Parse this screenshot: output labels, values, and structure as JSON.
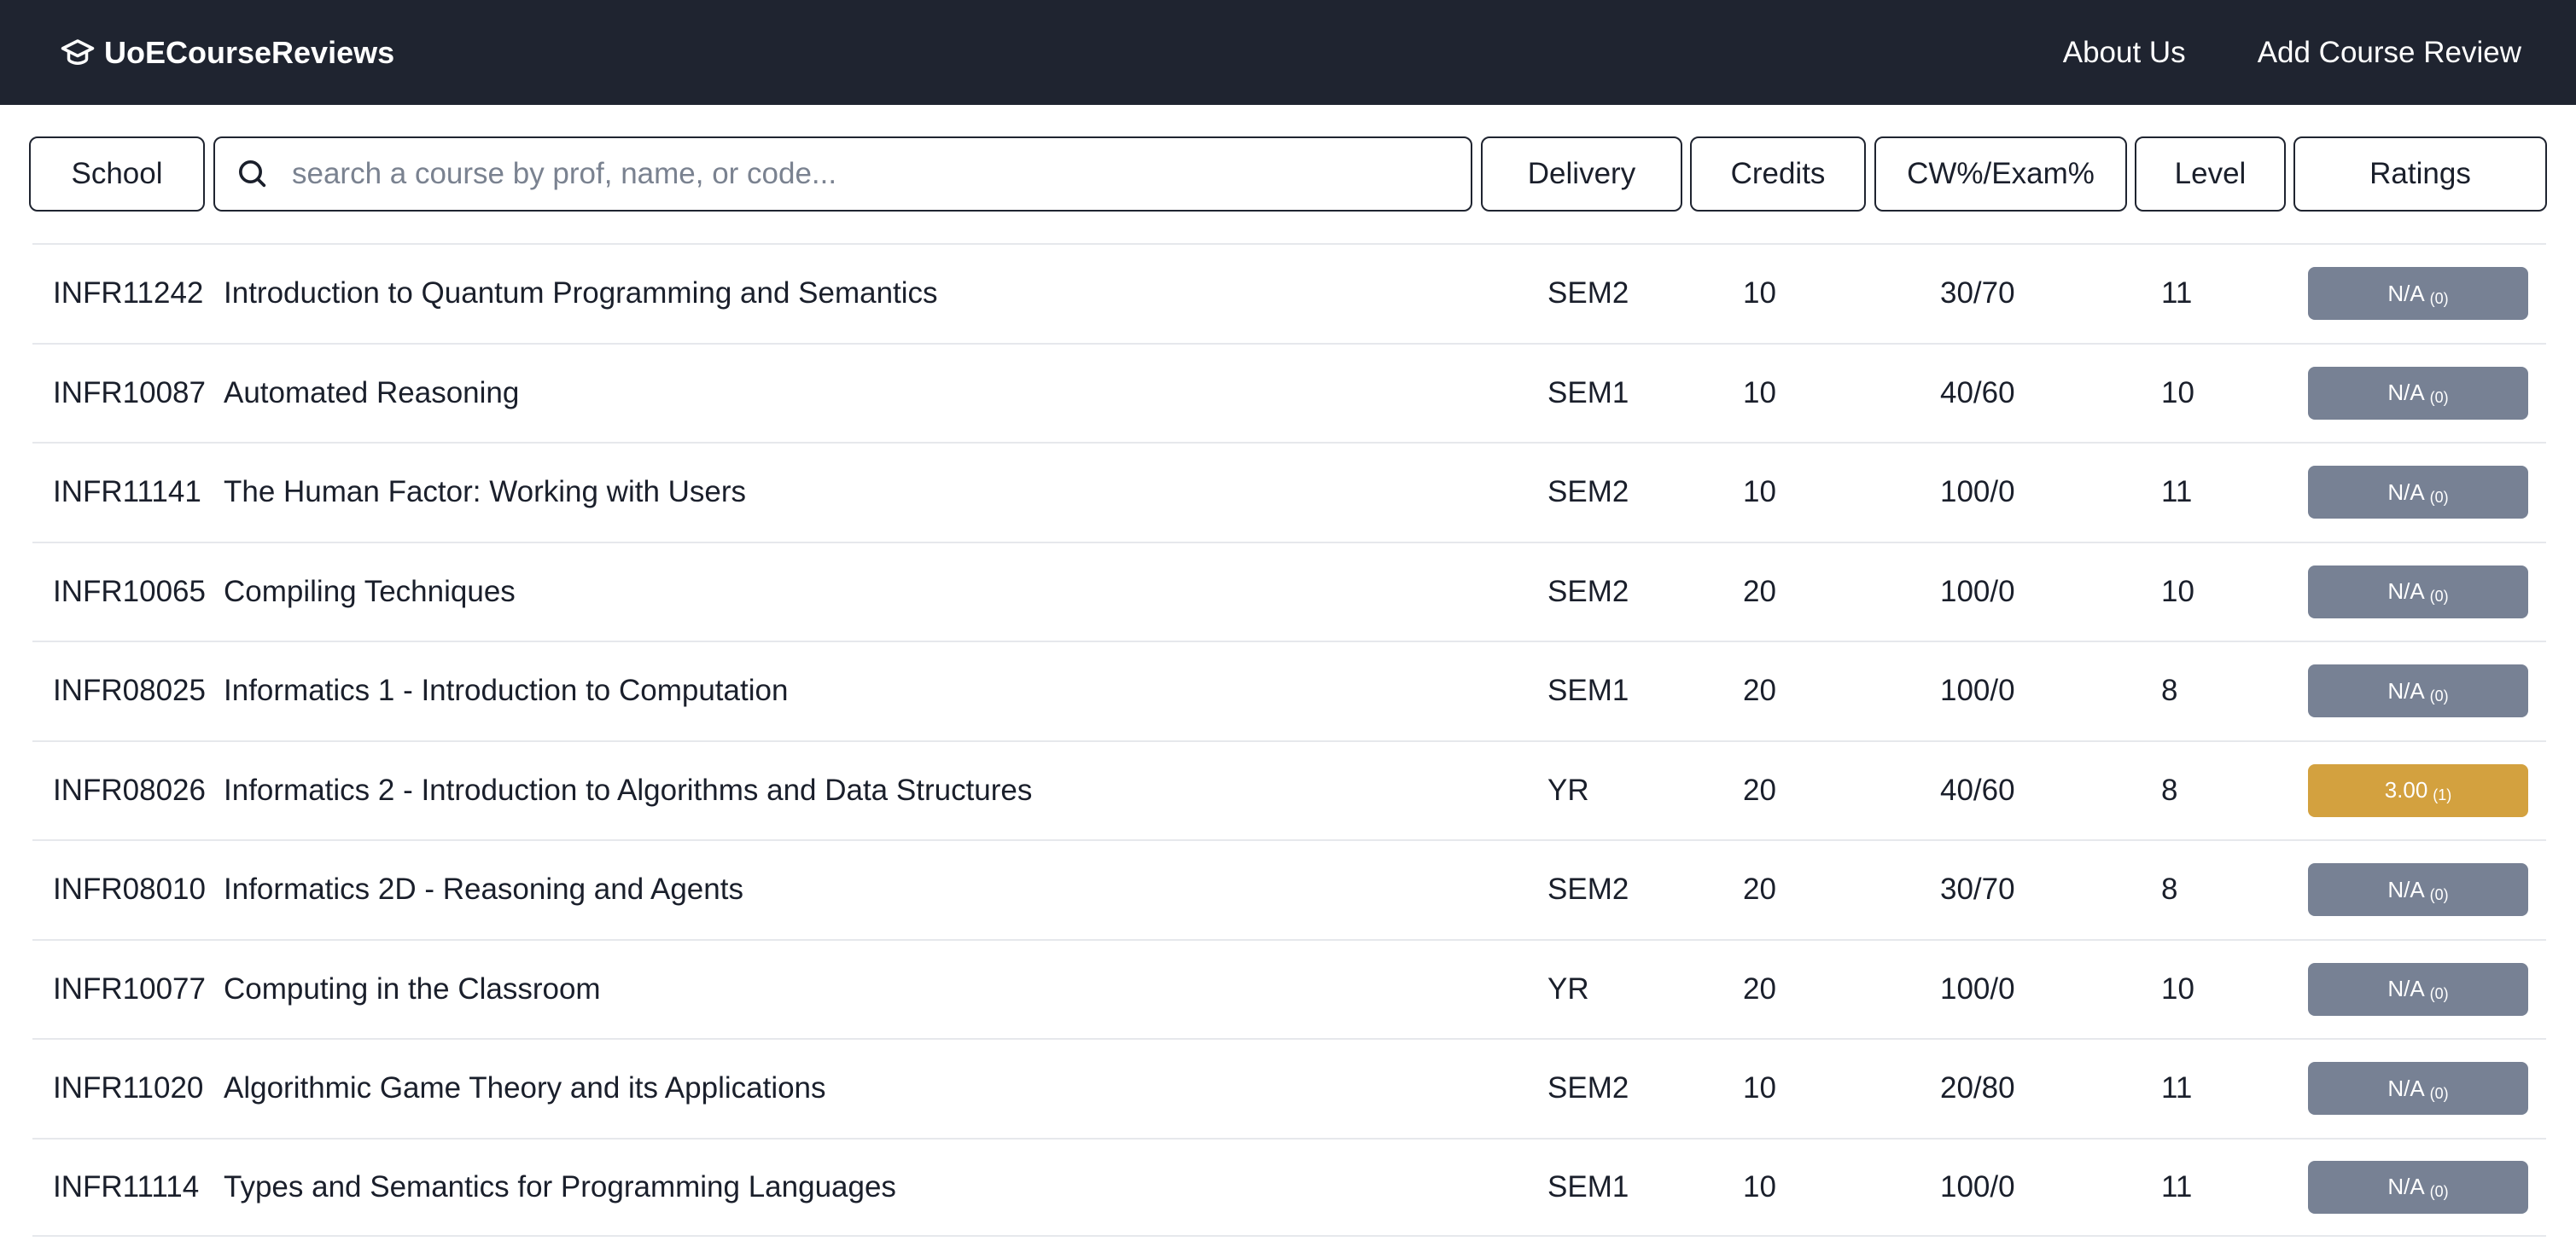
{
  "navbar": {
    "brand": "UoECourseReviews",
    "links": [
      "About Us",
      "Add Course Review"
    ]
  },
  "filters": {
    "school_label": "School",
    "search_placeholder": "search a course by prof, name, or code...",
    "search_value": "",
    "delivery_label": "Delivery",
    "credits_label": "Credits",
    "ratio_label": "CW%/Exam%",
    "level_label": "Level",
    "ratings_label": "Ratings"
  },
  "colors": {
    "navbar_bg": "#1f2430",
    "rating_na": "#778194",
    "rating_scored": "#d3a13f"
  },
  "courses": [
    {
      "code": "INFR11242",
      "name": "Introduction to Quantum Programming and Semantics",
      "delivery": "SEM2",
      "credits": "10",
      "ratio": "30/70",
      "level": "11",
      "rating": "N/A",
      "count": "(0)",
      "rated": false
    },
    {
      "code": "INFR10087",
      "name": "Automated Reasoning",
      "delivery": "SEM1",
      "credits": "10",
      "ratio": "40/60",
      "level": "10",
      "rating": "N/A",
      "count": "(0)",
      "rated": false
    },
    {
      "code": "INFR11141",
      "name": "The Human Factor: Working with Users",
      "delivery": "SEM2",
      "credits": "10",
      "ratio": "100/0",
      "level": "11",
      "rating": "N/A",
      "count": "(0)",
      "rated": false
    },
    {
      "code": "INFR10065",
      "name": "Compiling Techniques",
      "delivery": "SEM2",
      "credits": "20",
      "ratio": "100/0",
      "level": "10",
      "rating": "N/A",
      "count": "(0)",
      "rated": false
    },
    {
      "code": "INFR08025",
      "name": "Informatics 1 - Introduction to Computation",
      "delivery": "SEM1",
      "credits": "20",
      "ratio": "100/0",
      "level": "8",
      "rating": "N/A",
      "count": "(0)",
      "rated": false
    },
    {
      "code": "INFR08026",
      "name": "Informatics 2 - Introduction to Algorithms and Data Structures",
      "delivery": "YR",
      "credits": "20",
      "ratio": "40/60",
      "level": "8",
      "rating": "3.00",
      "count": "(1)",
      "rated": true
    },
    {
      "code": "INFR08010",
      "name": "Informatics 2D - Reasoning and Agents",
      "delivery": "SEM2",
      "credits": "20",
      "ratio": "30/70",
      "level": "8",
      "rating": "N/A",
      "count": "(0)",
      "rated": false
    },
    {
      "code": "INFR10077",
      "name": "Computing in the Classroom",
      "delivery": "YR",
      "credits": "20",
      "ratio": "100/0",
      "level": "10",
      "rating": "N/A",
      "count": "(0)",
      "rated": false
    },
    {
      "code": "INFR11020",
      "name": "Algorithmic Game Theory and its Applications",
      "delivery": "SEM2",
      "credits": "10",
      "ratio": "20/80",
      "level": "11",
      "rating": "N/A",
      "count": "(0)",
      "rated": false
    },
    {
      "code": "INFR11114",
      "name": "Types and Semantics for Programming Languages",
      "delivery": "SEM1",
      "credits": "10",
      "ratio": "100/0",
      "level": "11",
      "rating": "N/A",
      "count": "(0)",
      "rated": false
    }
  ]
}
